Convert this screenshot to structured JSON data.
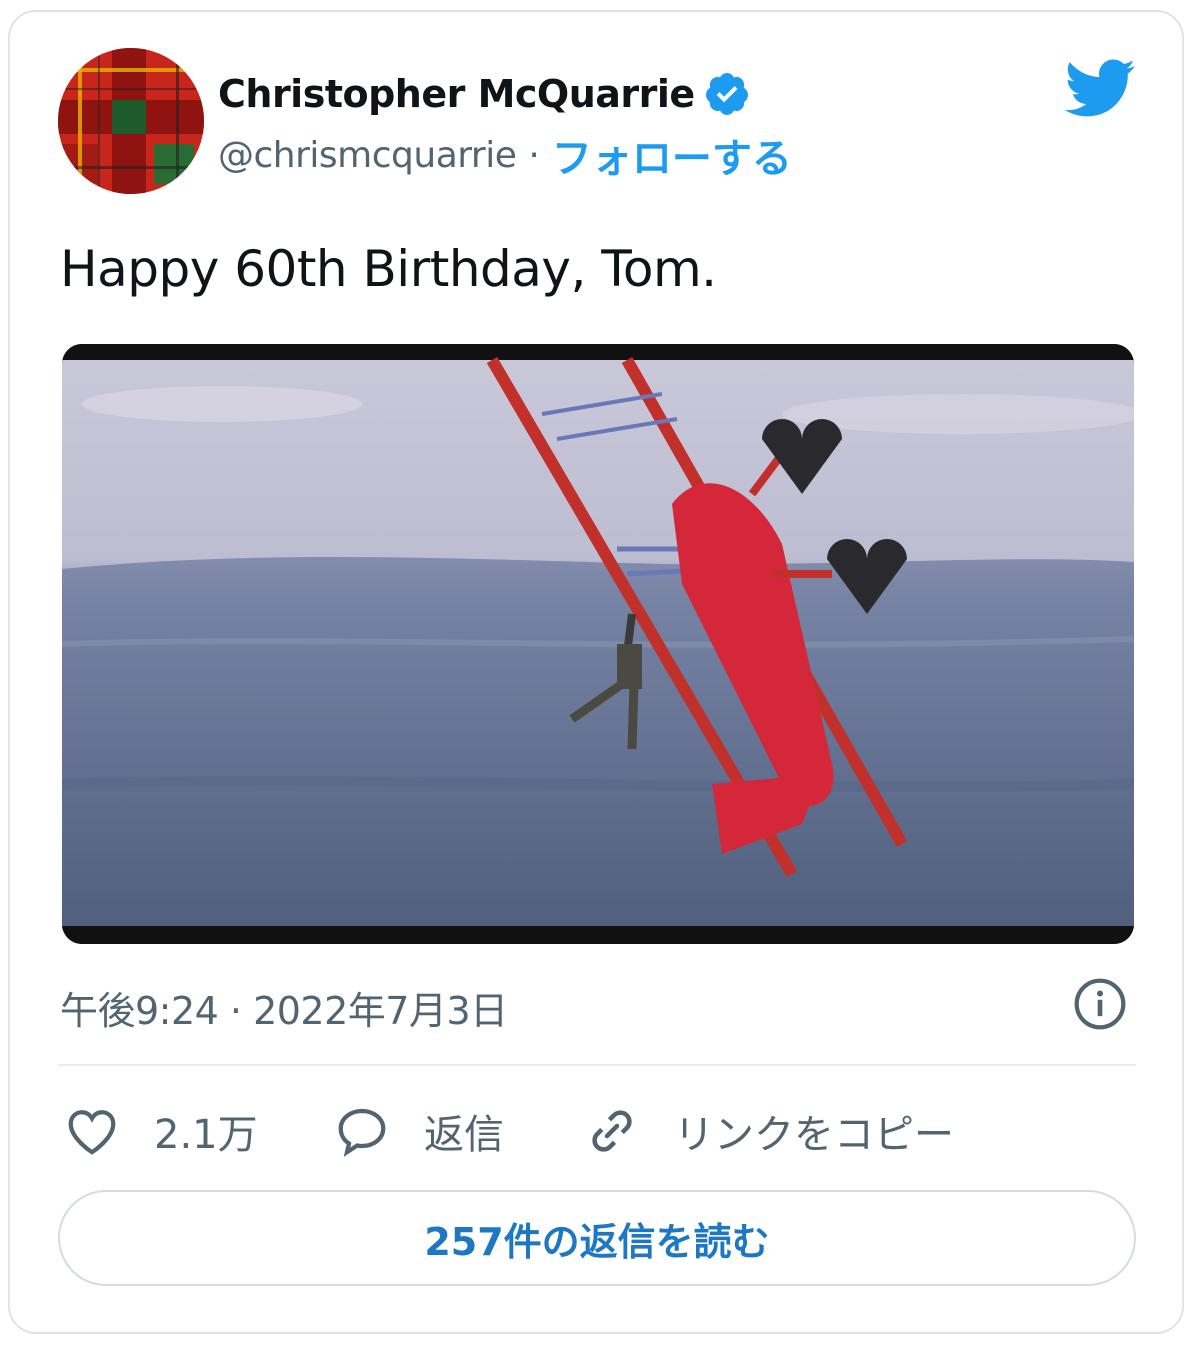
{
  "author": {
    "display_name": "Christopher McQuarrie",
    "handle": "@chrismcquarrie",
    "separator": "·",
    "follow_label": "フォローする",
    "verified_icon": "verified-badge-icon",
    "avatar": "tartan-pattern-avatar"
  },
  "brand": {
    "logo": "twitter-bird-icon",
    "accent_color": "#1d9bf0"
  },
  "tweet": {
    "text": "Happy 60th Birthday, Tom.",
    "media": "photo of a red biplane banking steeply over a landscape with a man hanging off the wing",
    "timestamp": "午後9:24 · 2022年7月3日"
  },
  "actions": {
    "like_count": "2.1万",
    "reply_label": "返信",
    "copy_link_label": "リンクをコピー"
  },
  "read_replies_label": "257件の返信を読む"
}
